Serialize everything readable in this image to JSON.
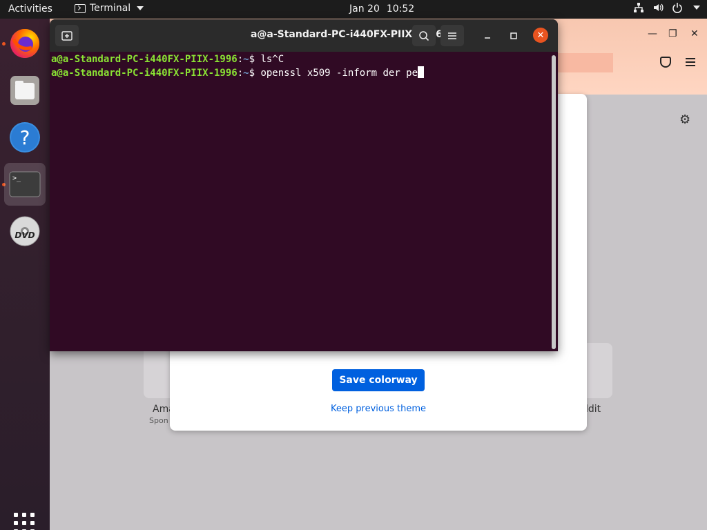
{
  "topbar": {
    "activities": "Activities",
    "app_name": "Terminal",
    "date": "Jan 20",
    "time": "10:52"
  },
  "dock": {
    "items": [
      {
        "name": "firefox",
        "icon": "firefox-icon",
        "running": true
      },
      {
        "name": "files",
        "icon": "files-icon",
        "running": false
      },
      {
        "name": "help",
        "icon": "help-icon",
        "running": false
      },
      {
        "name": "terminal",
        "icon": "terminal-icon",
        "running": true,
        "active": true
      },
      {
        "name": "dvd",
        "icon": "dvd-icon",
        "running": false
      }
    ],
    "dvd_label": "DVD"
  },
  "terminal": {
    "title": "a@a-Standard-PC-i440FX-PIIX-1996: ~",
    "lines": [
      {
        "user": "a@a-Standard-PC-i440FX-PIIX-1996",
        "path": "~",
        "command": "ls^C"
      },
      {
        "user": "a@a-Standard-PC-i440FX-PIIX-1996",
        "path": "~",
        "command": "openssl x509 -inform der pe"
      }
    ]
  },
  "firefox": {
    "dialog": {
      "save_label": "Save colorway",
      "keep_label": "Keep previous theme"
    },
    "tiles": [
      {
        "label": "Ama",
        "sub": "Spon"
      },
      {
        "label": "ldit",
        "sub": ""
      }
    ]
  },
  "colors": {
    "terminal_bg": "#300a24",
    "accent": "#e95420",
    "prompt_user": "#8ae234",
    "prompt_path": "#729fcf",
    "button_blue": "#0060df"
  }
}
